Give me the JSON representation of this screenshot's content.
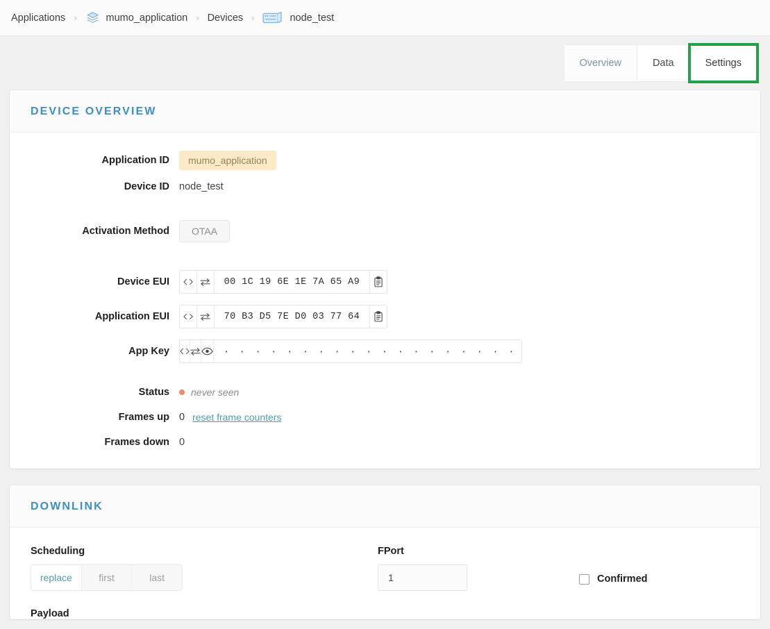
{
  "breadcrumb": {
    "separator": "›",
    "items": [
      {
        "label": "Applications",
        "icon": null
      },
      {
        "label": "mumo_application",
        "icon": "application-stack-icon"
      },
      {
        "label": "Devices",
        "icon": null
      },
      {
        "label": "node_test",
        "icon": "device-node-icon"
      }
    ]
  },
  "tabs": [
    {
      "label": "Overview",
      "state": "active"
    },
    {
      "label": "Data",
      "state": "plain"
    },
    {
      "label": "Settings",
      "state": "highlighted"
    }
  ],
  "highlight": {
    "color": "#22a04a"
  },
  "device_overview": {
    "title": "DEVICE OVERVIEW",
    "application_id": {
      "label": "Application ID",
      "value": "mumo_application",
      "badge_bg": "#fce9c6",
      "badge_fg": "#9a8258"
    },
    "device_id": {
      "label": "Device ID",
      "value": "node_test"
    },
    "activation_method": {
      "label": "Activation Method",
      "value": "OTAA"
    },
    "device_eui": {
      "label": "Device EUI",
      "value": "00 1C 19 6E 1E 7A 65 A9",
      "code_icon": "code-brackets-icon",
      "swap_icon": "byte-order-swap-icon",
      "copy_icon": "clipboard-copy-icon"
    },
    "application_eui": {
      "label": "Application EUI",
      "value": "70 B3 D5 7E D0 03 77 64",
      "code_icon": "code-brackets-icon",
      "swap_icon": "byte-order-swap-icon",
      "copy_icon": "clipboard-copy-icon"
    },
    "app_key": {
      "label": "App Key",
      "value": "· · · · · · · · · · · · · · · · · · · · · · · · · · · · · · · ·",
      "masked": true,
      "code_icon": "code-brackets-icon",
      "swap_icon": "byte-order-swap-icon",
      "reveal_icon": "eye-reveal-icon",
      "copy_icon": "clipboard-copy-icon"
    },
    "status": {
      "label": "Status",
      "value": "never seen",
      "dot_color": "#f28b6c"
    },
    "frames_up": {
      "label": "Frames up",
      "value": "0",
      "link": "reset frame counters"
    },
    "frames_down": {
      "label": "Frames down",
      "value": "0"
    }
  },
  "downlink": {
    "title": "DOWNLINK",
    "scheduling": {
      "label": "Scheduling",
      "options": [
        "replace",
        "first",
        "last"
      ],
      "selected": "replace"
    },
    "fport": {
      "label": "FPort",
      "value": "1"
    },
    "confirmed": {
      "label": "Confirmed",
      "checked": false
    },
    "payload": {
      "label": "Payload"
    }
  }
}
